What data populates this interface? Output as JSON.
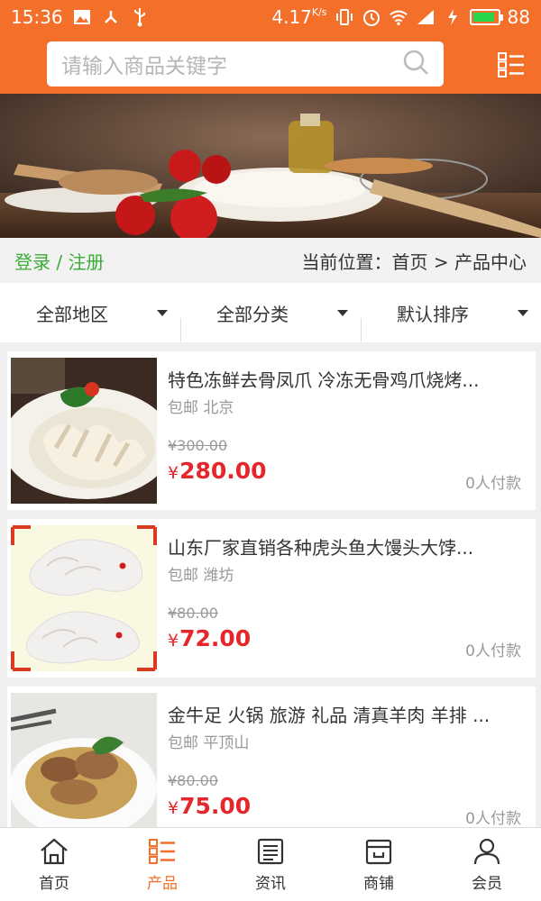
{
  "status_bar": {
    "time": "15:36",
    "speed": "4.17",
    "speed_unit": "K/s",
    "battery": "88",
    "battery_level": 0.88,
    "network": "4G"
  },
  "header": {
    "search_placeholder": "请输入商品关键字",
    "accent": "#f36f2a"
  },
  "breadcrumb": {
    "login_label": "登录 / 注册",
    "current_label": "当前位置：",
    "home": "首页",
    "separator": ">",
    "current": "产品中心"
  },
  "filters": [
    {
      "label": "全部地区"
    },
    {
      "label": "全部分类"
    },
    {
      "label": "默认排序"
    }
  ],
  "products": [
    {
      "title": "特色冻鲜去骨凤爪 冷冻无骨鸡爪烧烤...",
      "shipping": "包邮",
      "location": "北京",
      "old_price": "¥300.00",
      "price_symbol": "¥",
      "price": "280.00",
      "paid": "0人付款"
    },
    {
      "title": "山东厂家直销各种虎头鱼大馒头大饽...",
      "shipping": "包邮",
      "location": "潍坊",
      "old_price": "¥80.00",
      "price_symbol": "¥",
      "price": "72.00",
      "paid": "0人付款"
    },
    {
      "title": "金牛足 火锅 旅游 礼品 清真羊肉 羊排 ...",
      "shipping": "包邮",
      "location": "平顶山",
      "old_price": "¥80.00",
      "price_symbol": "¥",
      "price": "75.00",
      "paid": "0人付款"
    }
  ],
  "bottom_nav": [
    {
      "label": "首页",
      "icon": "home-icon"
    },
    {
      "label": "产品",
      "icon": "product-list-icon",
      "active": true
    },
    {
      "label": "资讯",
      "icon": "news-icon"
    },
    {
      "label": "商铺",
      "icon": "shop-icon"
    },
    {
      "label": "会员",
      "icon": "user-icon"
    }
  ],
  "colors": {
    "price": "#e5262a",
    "login": "#3bad36",
    "active_nav": "#f36f2a"
  }
}
